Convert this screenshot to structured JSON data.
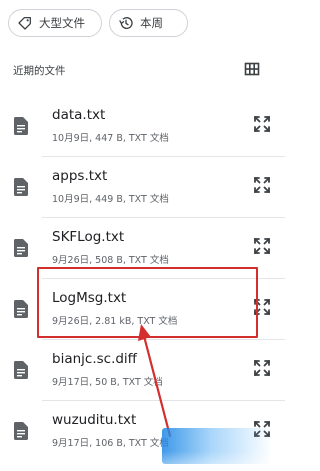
{
  "filters": {
    "large_files": {
      "label": "大型文件",
      "icon": "tag-icon"
    },
    "this_week": {
      "label": "本周",
      "icon": "history-icon"
    }
  },
  "recent": {
    "title": "近期的文件",
    "view_toggle_icon": "grid-view-icon"
  },
  "files": [
    {
      "name": "data.txt",
      "meta": "10月9日, 447 B, TXT 文档"
    },
    {
      "name": "apps.txt",
      "meta": "10月9日, 449 B, TXT 文档"
    },
    {
      "name": "SKFLog.txt",
      "meta": "9月26日, 508 B, TXT 文档"
    },
    {
      "name": "LogMsg.txt",
      "meta": "9月26日, 2.81 kB, TXT 文档"
    },
    {
      "name": "bianjc.sc.diff",
      "meta": "9月17日, 50 B, TXT 文档"
    },
    {
      "name": "wuzuditu.txt",
      "meta": "9月17日, 106 B, TXT 文档"
    }
  ],
  "colors": {
    "annotation": "#d32f2f",
    "icon": "#5f6368",
    "divider": "#e3e5e8"
  }
}
